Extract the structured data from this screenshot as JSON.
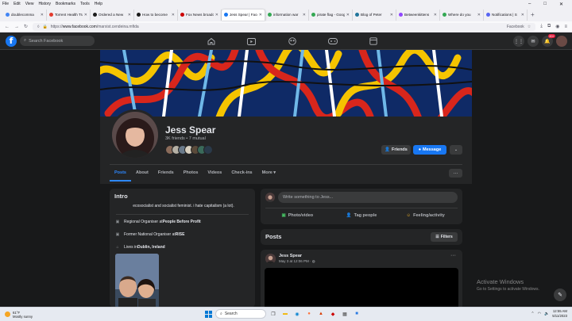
{
  "browser": {
    "menu": [
      "File",
      "Edit",
      "View",
      "History",
      "Bookmarks",
      "Tools",
      "Help"
    ],
    "tabs": [
      {
        "title": "doublecomma",
        "color": "#4285f4"
      },
      {
        "title": "Torrent Health Tracker",
        "color": "#e33b2e"
      },
      {
        "title": "Ordered a New",
        "color": "#1b1b1b"
      },
      {
        "title": "How to become",
        "color": "#1b1b1b"
      },
      {
        "title": "Fox News broadcast",
        "color": "#cc0000"
      },
      {
        "title": "Jess Spear | Facebook",
        "color": "#1877f2"
      },
      {
        "title": "information war",
        "color": "#34a853"
      },
      {
        "title": "pirate flag - Google",
        "color": "#34a853"
      },
      {
        "title": "Blog of Peter",
        "color": "#21759b"
      },
      {
        "title": "Betweenkittens",
        "color": "#9146ff"
      },
      {
        "title": "Where do you",
        "color": "#34a853"
      },
      {
        "title": "Notifications | S",
        "color": "#5865f2"
      }
    ],
    "active_tab_index": 5,
    "url_scheme": "https://",
    "url_host": "www.facebook.com",
    "url_path": "/marxist.cendeina.mfida",
    "url_right_label": "Facebook"
  },
  "fb": {
    "search_placeholder": "Search Facebook",
    "notifications_badge": "20+",
    "profile": {
      "name": "Jess Spear",
      "friends_summary": "3K friends • 7 mutual",
      "friends_button": "Friends",
      "message_button": "Message",
      "tabs": [
        "Posts",
        "About",
        "Friends",
        "Photos",
        "Videos",
        "Check-ins",
        "More ▾"
      ],
      "active_tab": "Posts"
    },
    "intro": {
      "title": "Intro",
      "bio": "ecosocialist and socialist feminist. i hate capitalism (a lot).",
      "rows": [
        {
          "icon": "briefcase-icon",
          "prefix": "Regional Organiser at ",
          "bold": "People Before Profit"
        },
        {
          "icon": "briefcase-icon",
          "prefix": "Former National Organiser at ",
          "bold": "RISE"
        },
        {
          "icon": "home-icon",
          "prefix": "Lives in ",
          "bold": "Dublin, Ireland"
        }
      ]
    },
    "composer": {
      "placeholder": "Write something to Jess...",
      "actions": [
        "Photo/video",
        "Tag people",
        "Feeling/activity"
      ]
    },
    "posts": {
      "title": "Posts",
      "filters": "Filters",
      "first_post": {
        "author": "Jess Spear",
        "meta": "May 3 at 12:06 PM ·"
      }
    }
  },
  "windows": {
    "activate_title": "Activate Windows",
    "activate_sub": "Go to Settings to activate Windows.",
    "weather_temp": "61°F",
    "weather_desc": "Mostly sunny",
    "search_label": "Search",
    "time": "12:55 AM",
    "date": "5/11/2023"
  }
}
